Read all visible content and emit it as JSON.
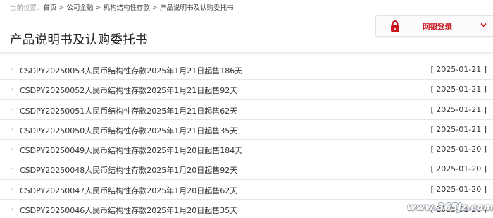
{
  "breadcrumb": {
    "label": "当前位置：",
    "items": [
      "首页",
      "公司金融",
      "机构结构性存款",
      "产品说明书及认购委托书"
    ],
    "separator": ">"
  },
  "page_title": "产品说明书及认购委托书",
  "login": {
    "label": "网银登录",
    "lock_icon": "lock-icon",
    "chevron_icon": "chevron-down-icon",
    "accent_color": "#c8161e"
  },
  "list": {
    "bullet": "·",
    "items": [
      {
        "title": "CSDPY20250053人民币结构性存款2025年1月21日起售186天",
        "date": "[ 2025-01-21 ]"
      },
      {
        "title": "CSDPY20250052人民币结构性存款2025年1月21日起售92天",
        "date": "[ 2025-01-21 ]"
      },
      {
        "title": "CSDPY20250051人民币结构性存款2025年1月21日起售62天",
        "date": "[ 2025-01-21 ]"
      },
      {
        "title": "CSDPY20250050人民币结构性存款2025年1月21日起售35天",
        "date": "[ 2025-01-21 ]"
      },
      {
        "title": "CSDPY20250049人民币结构性存款2025年1月20日起售184天",
        "date": "[ 2025-01-20 ]"
      },
      {
        "title": "CSDPY20250048人民币结构性存款2025年1月20日起售92天",
        "date": "[ 2025-01-20 ]"
      },
      {
        "title": "CSDPY20250047人民币结构性存款2025年1月20日起售62天",
        "date": "[ 2025-01-20 ]"
      },
      {
        "title": "CSDPY20250046人民币结构性存款2025年1月20日起售35天",
        "date": "[ 2025-01-20 ]"
      }
    ]
  },
  "watermark": "www.365jz.com"
}
